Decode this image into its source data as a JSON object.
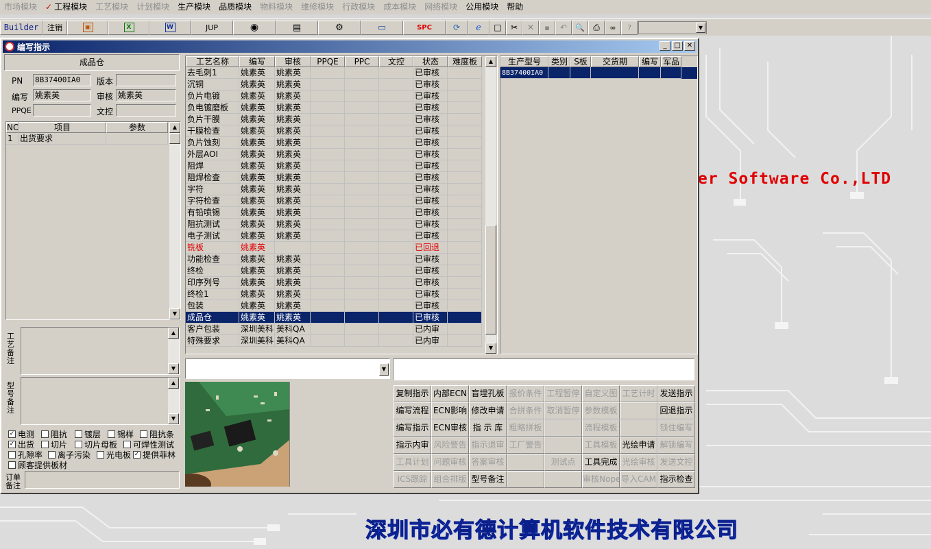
{
  "menu": [
    "市场模块",
    "工程模块",
    "工艺模块",
    "计划模块",
    "生产模块",
    "品质模块",
    "物料模块",
    "维修模块",
    "行政模块",
    "成本模块",
    "网络模块",
    "公用模块",
    "帮助"
  ],
  "menu_check": "✓",
  "toolbar": {
    "builder": "Builder",
    "logout": "注销",
    "jup": "JUP",
    "spc": "SPC"
  },
  "window": {
    "title": "编写指示"
  },
  "left": {
    "panel_title": "成品仓",
    "pn_label": "PN",
    "pn_value": "8B37400IA0",
    "version_label": "版本",
    "version_value": "",
    "author_label": "编写",
    "author_value": "姚素英",
    "review_label": "审核",
    "review_value": "姚素英",
    "ppqe_label": "PPQE",
    "ppqe_value": "",
    "doc_label": "文控",
    "doc_value": "",
    "grid_headers": [
      "NO",
      "项目",
      "参数"
    ],
    "grid_rows": [
      {
        "no": "1",
        "item": "出货要求",
        "param": ""
      }
    ],
    "process_note_label": "工艺备注",
    "model_note_label": "型号备注",
    "order_note_label": "订单备注",
    "checkboxes": [
      [
        {
          "label": "电测",
          "checked": true
        },
        {
          "label": "阻抗",
          "checked": false
        },
        {
          "label": "镀层",
          "checked": false
        },
        {
          "label": "锡样",
          "checked": false
        },
        {
          "label": "阻抗条",
          "checked": false
        }
      ],
      [
        {
          "label": "出货",
          "checked": true
        },
        {
          "label": "切片",
          "checked": false
        },
        {
          "label": "切片母板",
          "checked": false
        },
        {
          "label": "可焊性测试",
          "checked": false
        }
      ],
      [
        {
          "label": "孔隙率",
          "checked": false
        },
        {
          "label": "离子污染",
          "checked": false
        },
        {
          "label": "光电板",
          "checked": false
        },
        {
          "label": "提供菲林",
          "checked": true
        }
      ],
      [
        {
          "label": "顾客提供板材",
          "checked": false
        }
      ]
    ]
  },
  "process": {
    "headers": [
      "工艺名称",
      "编写",
      "审核",
      "PPQE",
      "PPC",
      "文控",
      "状态",
      "难度板"
    ],
    "rows": [
      {
        "name": "去毛刺1",
        "author": "姚素英",
        "review": "姚素英",
        "status": "已审核"
      },
      {
        "name": "沉铜",
        "author": "姚素英",
        "review": "姚素英",
        "status": "已审核"
      },
      {
        "name": "负片电镀",
        "author": "姚素英",
        "review": "姚素英",
        "status": "已审核"
      },
      {
        "name": "负电镀磨板",
        "author": "姚素英",
        "review": "姚素英",
        "status": "已审核"
      },
      {
        "name": "负片干膜",
        "author": "姚素英",
        "review": "姚素英",
        "status": "已审核"
      },
      {
        "name": "干膜检查",
        "author": "姚素英",
        "review": "姚素英",
        "status": "已审核"
      },
      {
        "name": "负片蚀刻",
        "author": "姚素英",
        "review": "姚素英",
        "status": "已审核"
      },
      {
        "name": "外层AOI",
        "author": "姚素英",
        "review": "姚素英",
        "status": "已审核"
      },
      {
        "name": "阻焊",
        "author": "姚素英",
        "review": "姚素英",
        "status": "已审核"
      },
      {
        "name": "阻焊检查",
        "author": "姚素英",
        "review": "姚素英",
        "status": "已审核"
      },
      {
        "name": "字符",
        "author": "姚素英",
        "review": "姚素英",
        "status": "已审核"
      },
      {
        "name": "字符检查",
        "author": "姚素英",
        "review": "姚素英",
        "status": "已审核"
      },
      {
        "name": "有铅喷锡",
        "author": "姚素英",
        "review": "姚素英",
        "status": "已审核"
      },
      {
        "name": "阻抗测试",
        "author": "姚素英",
        "review": "姚素英",
        "status": "已审核"
      },
      {
        "name": "电子测试",
        "author": "姚素英",
        "review": "姚素英",
        "status": "已审核"
      },
      {
        "name": "铣板",
        "author": "姚素英",
        "review": "",
        "status": "已回退",
        "red": true
      },
      {
        "name": "功能检查",
        "author": "姚素英",
        "review": "姚素英",
        "status": "已审核"
      },
      {
        "name": "终检",
        "author": "姚素英",
        "review": "姚素英",
        "status": "已审核"
      },
      {
        "name": "印序列号",
        "author": "姚素英",
        "review": "姚素英",
        "status": "已审核"
      },
      {
        "name": "终检1",
        "author": "姚素英",
        "review": "姚素英",
        "status": "已审核"
      },
      {
        "name": "包装",
        "author": "姚素英",
        "review": "姚素英",
        "status": "已审核"
      },
      {
        "name": "成品仓",
        "author": "姚素英",
        "review": "姚素英",
        "status": "已审核",
        "selected": true
      },
      {
        "name": "客户包装",
        "author": "深圳美科",
        "review": "美科QA",
        "status": "已内审"
      },
      {
        "name": "特殊要求",
        "author": "深圳美科",
        "review": "美科QA",
        "status": "已内审"
      }
    ]
  },
  "models": {
    "headers": [
      "生产型号",
      "类别",
      "S板",
      "交货期",
      "编写",
      "军品"
    ],
    "rows": [
      {
        "model": "8B37400IA0",
        "selected": true
      }
    ]
  },
  "actions": [
    [
      {
        "l": "复制指示",
        "e": true
      },
      {
        "l": "内部ECN",
        "e": true
      },
      {
        "l": "盲埋孔板",
        "e": true
      },
      {
        "l": "报价条件",
        "e": false
      },
      {
        "l": "工程暂停",
        "e": false
      },
      {
        "l": "自定义图",
        "e": false
      },
      {
        "l": "工艺计时",
        "e": false
      },
      {
        "l": "发送指示",
        "e": true
      }
    ],
    [
      {
        "l": "编写流程",
        "e": true
      },
      {
        "l": "ECN影响",
        "e": true
      },
      {
        "l": "修改申请",
        "e": true
      },
      {
        "l": "合拼条件",
        "e": false
      },
      {
        "l": "取消暂停",
        "e": false
      },
      {
        "l": "参数模板",
        "e": false
      },
      {
        "l": "",
        "e": false
      },
      {
        "l": "回退指示",
        "e": true
      }
    ],
    [
      {
        "l": "编写指示",
        "e": true
      },
      {
        "l": "ECN审核",
        "e": true
      },
      {
        "l": "指 示 库",
        "e": true
      },
      {
        "l": "粗略拼板",
        "e": false
      },
      {
        "l": "",
        "e": false
      },
      {
        "l": "流程模板",
        "e": false
      },
      {
        "l": "",
        "e": false
      },
      {
        "l": "锁住编写",
        "e": false
      }
    ],
    [
      {
        "l": "指示内审",
        "e": true
      },
      {
        "l": "风险警告",
        "e": false
      },
      {
        "l": "指示退审",
        "e": false
      },
      {
        "l": "工厂警告",
        "e": false
      },
      {
        "l": "",
        "e": false
      },
      {
        "l": "工具模板",
        "e": false
      },
      {
        "l": "光绘申请",
        "e": true
      },
      {
        "l": "解锁编写",
        "e": false
      }
    ],
    [
      {
        "l": "工具计划",
        "e": false
      },
      {
        "l": "问题审核",
        "e": false
      },
      {
        "l": "答案审核",
        "e": false
      },
      {
        "l": "",
        "e": false
      },
      {
        "l": "测试点",
        "e": false
      },
      {
        "l": "工具完成",
        "e": true
      },
      {
        "l": "光绘审核",
        "e": false
      },
      {
        "l": "发送文控",
        "e": false
      }
    ],
    [
      {
        "l": "ICS跟踪",
        "e": false
      },
      {
        "l": "组合排版",
        "e": false
      },
      {
        "l": "型号备注",
        "e": true
      },
      {
        "l": "",
        "e": false
      },
      {
        "l": "",
        "e": false
      },
      {
        "l": "审核Nope",
        "e": false
      },
      {
        "l": "导入CAM",
        "e": false
      },
      {
        "l": "指示检查",
        "e": true
      }
    ]
  ],
  "desktop": {
    "brand_en": "er Software Co.,LTD",
    "brand_cn": "深圳市必有德计算机软件技术有限公司"
  }
}
